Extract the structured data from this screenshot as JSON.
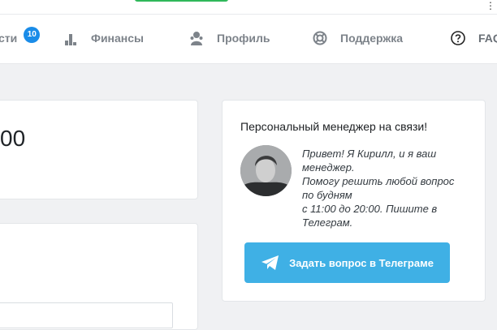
{
  "top_menu_glyph": "⋮",
  "nav": {
    "items": [
      {
        "label": "сти",
        "badge": "10",
        "icon": "none"
      },
      {
        "label": "Финансы",
        "icon": "bar-chart-icon"
      },
      {
        "label": "Профиль",
        "icon": "user-icon"
      },
      {
        "label": "Поддержка",
        "icon": "lifebuoy-icon"
      },
      {
        "label": "FAQ",
        "icon": "question-circle-icon"
      }
    ]
  },
  "balance": {
    "value_fragment": "00"
  },
  "manager": {
    "title": "Персональный менеджер на связи!",
    "text_lines": [
      "Привет! Я Кирилл, и я ваш",
      "менеджер.",
      "Помогу решить любой вопрос",
      "по будням",
      "с 11:00 до 20:00. Пишите в",
      "Телеграм."
    ],
    "button_label": "Задать вопрос в Телеграме",
    "button_icon": "telegram-icon"
  },
  "colors": {
    "accent_blue": "#1a8ce8",
    "telegram_button": "#3fb0e5",
    "nav_text": "#7d838a",
    "top_green": "#2fb85a"
  }
}
